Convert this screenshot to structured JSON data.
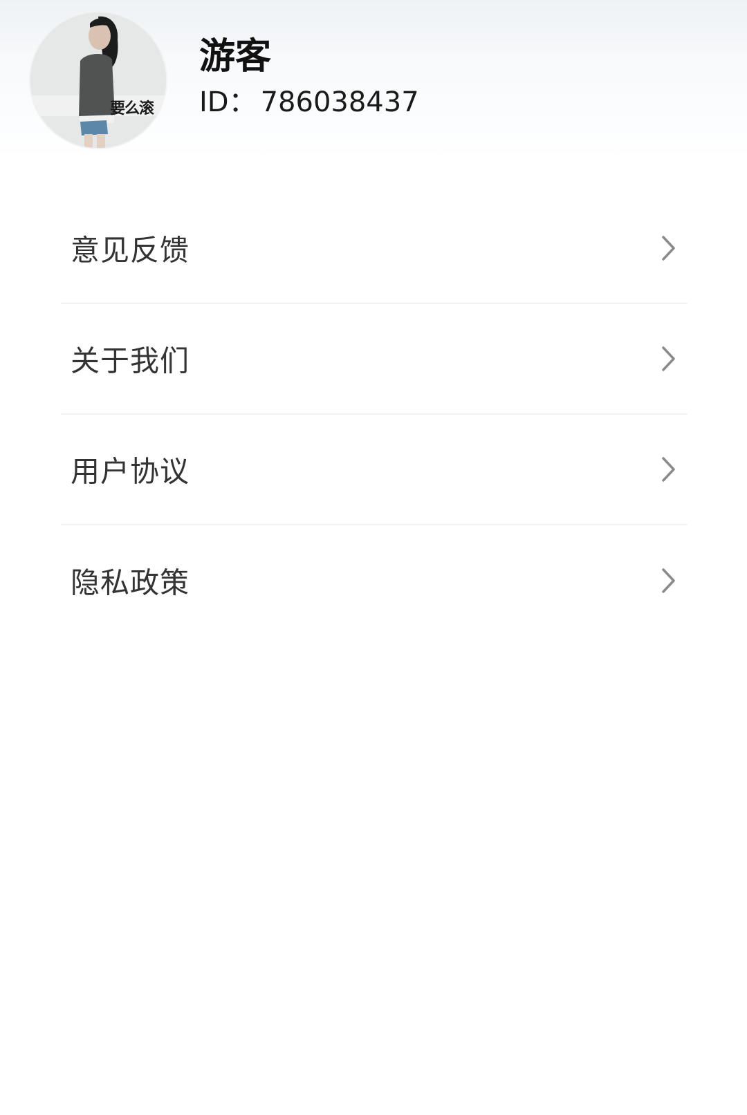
{
  "profile": {
    "avatar_caption": "要么滚",
    "username": "游客",
    "id_label": "ID：",
    "id_value": "786038437"
  },
  "menu": {
    "items": [
      {
        "label": "意见反馈",
        "icon": "chevron-right-icon"
      },
      {
        "label": "关于我们",
        "icon": "chevron-right-icon"
      },
      {
        "label": "用户协议",
        "icon": "chevron-right-icon"
      },
      {
        "label": "隐私政策",
        "icon": "chevron-right-icon"
      }
    ]
  },
  "colors": {
    "background": "#ffffff",
    "text_primary": "#111111",
    "text_menu": "#333333",
    "chevron": "#8a8a8a",
    "divider": "#f1f2f3"
  }
}
